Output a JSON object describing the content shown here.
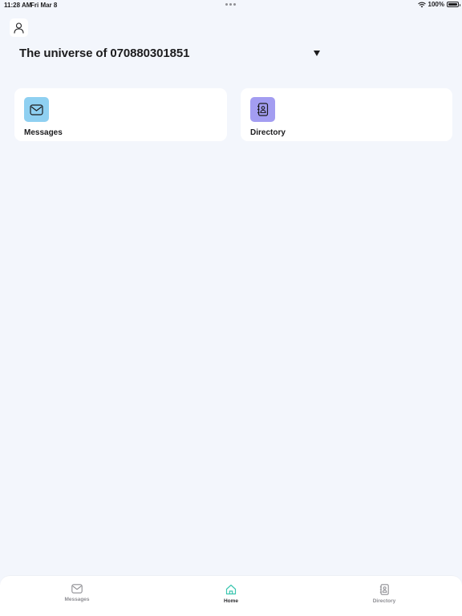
{
  "status_bar": {
    "time": "11:28 AM",
    "date": "Fri Mar 8",
    "battery": "100%"
  },
  "header": {
    "profile_icon": "person-icon",
    "universe_title": "The universe of 070880301851",
    "dropdown_icon": "triangle-down-icon"
  },
  "cards": [
    {
      "label": "Messages",
      "icon": "envelope-icon",
      "icon_bg": "#8fd0f1"
    },
    {
      "label": "Directory",
      "icon": "contact-book-icon",
      "icon_bg": "#a39df1"
    }
  ],
  "tab_bar": {
    "tabs": [
      {
        "label": "Messages",
        "icon": "envelope-icon",
        "active": false
      },
      {
        "label": "Home",
        "icon": "house-icon",
        "active": true
      },
      {
        "label": "Directory",
        "icon": "contact-book-icon",
        "active": false
      }
    ],
    "active_color": "#3cc6b0",
    "inactive_color": "#8e8e93"
  }
}
